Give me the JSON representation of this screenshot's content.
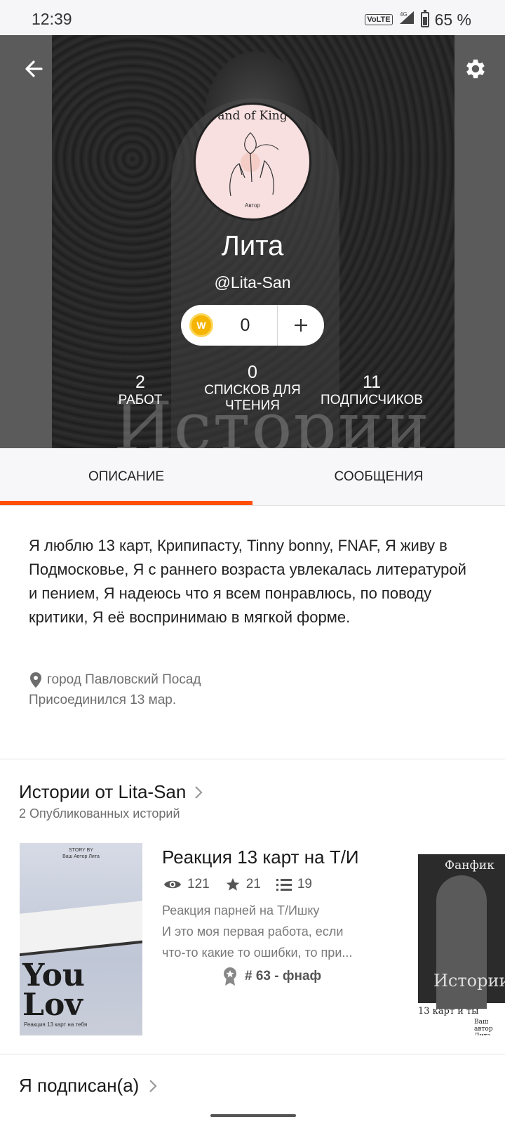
{
  "status_bar": {
    "time": "12:39",
    "network": "VoLTE",
    "signal_gen": "4G",
    "battery": "65 %",
    "battery_level": 0.65
  },
  "profile": {
    "avatar_title": "and of King",
    "avatar_caption": "Автор",
    "name": "Лита",
    "handle": "@Lita-San",
    "coins": "0",
    "coin_symbol": "W",
    "header_watermark": "Истории",
    "stats": [
      {
        "value": "2",
        "label": "Работ"
      },
      {
        "value": "0",
        "label": "Списков для чтения"
      },
      {
        "value": "11",
        "label": "Подписчиков"
      }
    ]
  },
  "tabs": [
    {
      "label": "Описание",
      "active": true
    },
    {
      "label": "Сообщения",
      "active": false
    }
  ],
  "about": {
    "text": "Я люблю 13 карт, Крипипасту, Tinny bonny, FNAF, Я живу в Подмосковье, Я с раннего возраста увлекалась литературой и пением, Я надеюсь что я всем понравлюсь, по поводу критики, Я её воспринимаю в мягкой форме.",
    "location": "город Павловский Посад",
    "joined": "Присоединился 13 мар."
  },
  "stories": {
    "title": "Истории от Lita-San",
    "subtitle": "2 Опубликованных историй",
    "items": [
      {
        "title": "Реакция 13 карт на Т/И",
        "reads": "121",
        "votes": "21",
        "parts": "19",
        "desc_line1": "Реакция парней на Т/Ишку",
        "desc_line2": "И это моя первая работа, если",
        "desc_line3": "что-то какие то ошибки, то при...",
        "tag": "# 63 - фнаф",
        "cover_top": "STORY BY",
        "cover_author": "Ваш Автор Лита",
        "cover_big": "You Lov",
        "cover_bottom": "Реакция 13 карт на тебя"
      },
      {
        "cover_title": "Фанфик",
        "cover_word": "Истории",
        "cover_sub": "13 карт и ты",
        "cover_author": "Ваш автор Лита"
      }
    ]
  },
  "following": {
    "title": "Я подписан(а)"
  },
  "colors": {
    "accent": "#ff500a",
    "header_bg": "#5b5b5b",
    "coin": "#f5b400"
  }
}
